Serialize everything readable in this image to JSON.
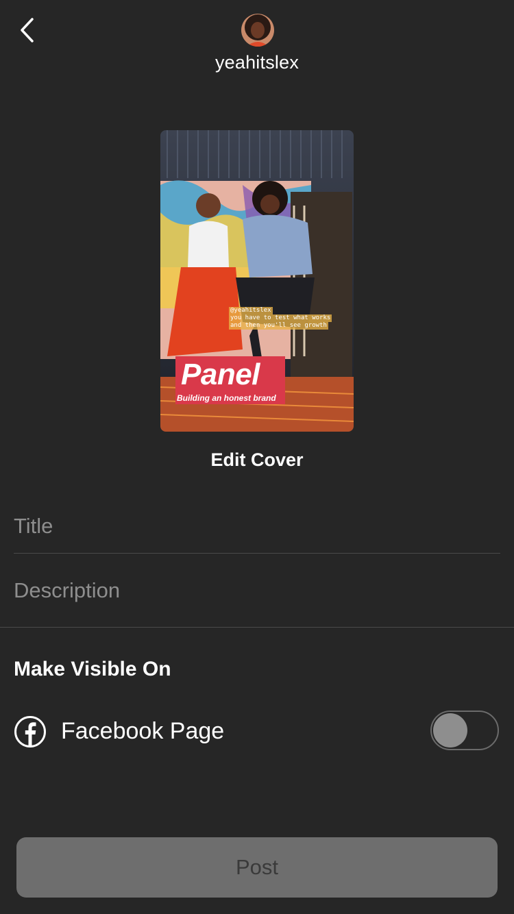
{
  "header": {
    "username": "yeahitslex",
    "back_icon": "chevron-left-icon",
    "avatar_icon": "profile-avatar"
  },
  "cover": {
    "title": "Panel",
    "subtitle": "Building an honest brand",
    "caption_lines": [
      "@yeahitslex",
      "you have to test what works",
      "and then you'll see growth"
    ],
    "edit_label": "Edit Cover"
  },
  "form": {
    "title_placeholder": "Title",
    "title_value": "",
    "description_placeholder": "Description",
    "description_value": ""
  },
  "visibility": {
    "heading": "Make Visible On",
    "facebook_label": "Facebook Page",
    "facebook_icon": "facebook-icon",
    "facebook_enabled": false
  },
  "actions": {
    "post_label": "Post"
  },
  "colors": {
    "background": "#262626",
    "post_button_bg": "#6e6e6e",
    "post_button_text": "#3a3a3a",
    "placeholder": "#8e8e8e",
    "cover_title_bg": "#d9394a"
  }
}
